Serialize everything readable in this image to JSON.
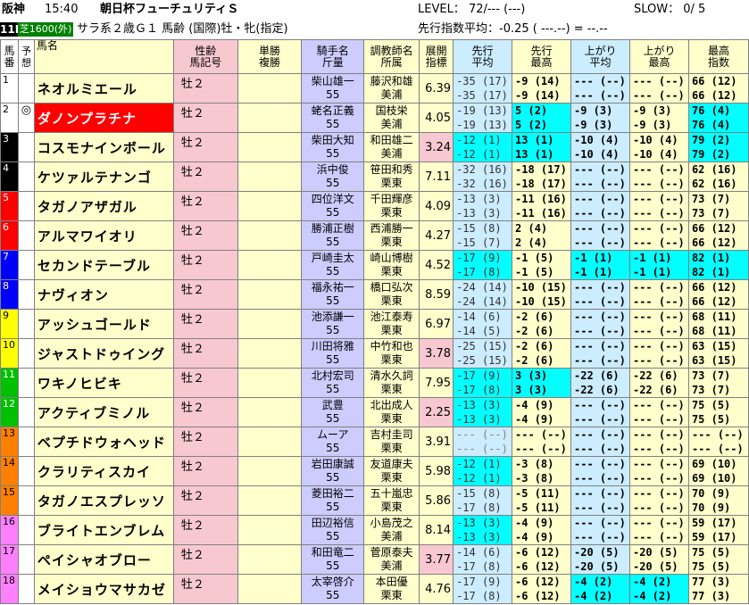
{
  "header": {
    "track": "阪神",
    "time": "15:40",
    "race_name": "朝日杯フューチュリティＳ",
    "level": "LEVEL： 72/--- (---)",
    "slow": "SLOW： 0/ 5",
    "race_no": "11R",
    "course": "芝1600(外)",
    "conditions": "サラ系２歳Ｇ１ 馬齢 (国際)牡・牝(指定)",
    "pace": "先行指数平均：-0.25 ( ---.--) = --.--"
  },
  "columns": {
    "umaban": "馬番",
    "yoso": "予想",
    "name": "馬名",
    "sex_age": "性齢\n馬記号",
    "odds": "単勝\n複勝",
    "jockey": "騎手名\n斤量",
    "trainer": "調教師名\n所属",
    "tenkai": "展開\n指標",
    "senko_avg": "先行\n平均",
    "senko_max": "先行\n最高",
    "agari_avg": "上がり\n平均",
    "agari_max": "上がり\n最高",
    "max_index": "最高\n指数"
  },
  "colors": {
    "waku1": "#ffffff",
    "waku2": "#ffffff",
    "waku3": "#000000",
    "waku4": "#000000",
    "waku5": "#ff0000",
    "waku6": "#ff0000",
    "waku7": "#0000ff",
    "waku8": "#0000ff",
    "waku9": "#ffff00",
    "waku10": "#ffff00",
    "waku11": "#00c000",
    "waku12": "#00c000",
    "waku13": "#ff8000",
    "waku14": "#ff8000",
    "waku15": "#ff8000",
    "waku16": "#ff80ff",
    "waku17": "#ff80ff",
    "waku18": "#ff80ff",
    "highlight": "#00ffff"
  },
  "horses": [
    {
      "no": "1",
      "mark": "",
      "name": "ネオルミエール",
      "sex": "牡２",
      "jockey": "柴山雄一",
      "weight": "55",
      "trainer": "藤沢和雄",
      "stable": "美浦",
      "tenkai": "6.39",
      "s1a": "-35 (17)",
      "s1b": "-35 (17)",
      "s2a": "-9 (14)",
      "s2b": "-9 (14)",
      "a1a": "--- (--)",
      "a1b": "--- (--)",
      "a2a": "--- (--)",
      "a2b": "--- (--)",
      "m1": "66 (12)",
      "m2": "66 (12)"
    },
    {
      "no": "2",
      "mark": "◎",
      "name": "ダノンプラチナ",
      "sex": "牡２",
      "jockey": "蛯名正義",
      "weight": "55",
      "trainer": "国枝栄",
      "stable": "美浦",
      "tenkai": "4.05",
      "s1a": "-19 (13)",
      "s1b": "-19 (13)",
      "s2a": "5 (2)",
      "s2b": "5 (2)",
      "a1a": "-9 (3)",
      "a1b": "-9 (3)",
      "a2a": "-9 (3)",
      "a2b": "-9 (3)",
      "m1": "76 (4)",
      "m2": "76 (4)"
    },
    {
      "no": "3",
      "mark": "",
      "name": "コスモナインボール",
      "sex": "牡２",
      "jockey": "柴田大知",
      "weight": "55",
      "trainer": "和田雄二",
      "stable": "美浦",
      "tenkai": "3.24",
      "s1a": "-12 (1)",
      "s1b": "-12 (1)",
      "s2a": "13 (1)",
      "s2b": "13 (1)",
      "a1a": "-10 (4)",
      "a1b": "-10 (4)",
      "a2a": "-10 (4)",
      "a2b": "-10 (4)",
      "m1": "79 (2)",
      "m2": "79 (2)"
    },
    {
      "no": "4",
      "mark": "",
      "name": "ケツァルテナンゴ",
      "sex": "牡２",
      "jockey": "浜中俊",
      "weight": "55",
      "trainer": "笹田和秀",
      "stable": "栗東",
      "tenkai": "7.11",
      "s1a": "-32 (16)",
      "s1b": "-32 (16)",
      "s2a": "-18 (17)",
      "s2b": "-18 (17)",
      "a1a": "--- (--)",
      "a1b": "--- (--)",
      "a2a": "--- (--)",
      "a2b": "--- (--)",
      "m1": "62 (16)",
      "m2": "62 (16)"
    },
    {
      "no": "5",
      "mark": "",
      "name": "タガノアザガル",
      "sex": "牡２",
      "jockey": "四位洋文",
      "weight": "55",
      "trainer": "千田輝彦",
      "stable": "栗東",
      "tenkai": "4.09",
      "s1a": "-13 (3)",
      "s1b": "-13 (3)",
      "s2a": "-11 (16)",
      "s2b": "-11 (16)",
      "a1a": "--- (--)",
      "a1b": "--- (--)",
      "a2a": "--- (--)",
      "a2b": "--- (--)",
      "m1": "73 (7)",
      "m2": "73 (7)"
    },
    {
      "no": "6",
      "mark": "",
      "name": "アルマワイオリ",
      "sex": "牡２",
      "jockey": "勝浦正樹",
      "weight": "55",
      "trainer": "西浦勝一",
      "stable": "栗東",
      "tenkai": "4.27",
      "s1a": "-15 (8)",
      "s1b": "-15 (7)",
      "s2a": "2 (4)",
      "s2b": "2 (4)",
      "a1a": "--- (--)",
      "a1b": "--- (--)",
      "a2a": "--- (--)",
      "a2b": "--- (--)",
      "m1": "66 (12)",
      "m2": "66 (12)"
    },
    {
      "no": "7",
      "mark": "",
      "name": "セカンドテーブル",
      "sex": "牡２",
      "jockey": "戸崎圭太",
      "weight": "55",
      "trainer": "崎山博樹",
      "stable": "栗東",
      "tenkai": "4.52",
      "s1a": "-17 (9)",
      "s1b": "-17 (8)",
      "s2a": "-1 (5)",
      "s2b": "-1 (5)",
      "a1a": "-1 (1)",
      "a1b": "-1 (1)",
      "a2a": "-1 (1)",
      "a2b": "-1 (1)",
      "m1": "82 (1)",
      "m2": "82 (1)"
    },
    {
      "no": "8",
      "mark": "",
      "name": "ナヴィオン",
      "sex": "牡２",
      "jockey": "福永祐一",
      "weight": "55",
      "trainer": "橋口弘次",
      "stable": "栗東",
      "tenkai": "8.59",
      "s1a": "-24 (14)",
      "s1b": "-24 (14)",
      "s2a": "-10 (15)",
      "s2b": "-10 (15)",
      "a1a": "--- (--)",
      "a1b": "--- (--)",
      "a2a": "--- (--)",
      "a2b": "--- (--)",
      "m1": "66 (12)",
      "m2": "66 (12)"
    },
    {
      "no": "9",
      "mark": "",
      "name": "アッシュゴールド",
      "sex": "牡２",
      "jockey": "池添謙一",
      "weight": "55",
      "trainer": "池江泰寿",
      "stable": "栗東",
      "tenkai": "6.97",
      "s1a": "-14 (6)",
      "s1b": "-14 (5)",
      "s2a": "-2 (6)",
      "s2b": "-2 (6)",
      "a1a": "--- (--)",
      "a1b": "--- (--)",
      "a2a": "--- (--)",
      "a2b": "--- (--)",
      "m1": "68 (11)",
      "m2": "68 (11)"
    },
    {
      "no": "10",
      "mark": "",
      "name": "ジャストドゥイング",
      "sex": "牡２",
      "jockey": "川田将雅",
      "weight": "55",
      "trainer": "中竹和也",
      "stable": "栗東",
      "tenkai": "3.78",
      "s1a": "-25 (15)",
      "s1b": "-25 (15)",
      "s2a": "-2 (6)",
      "s2b": "-2 (6)",
      "a1a": "--- (--)",
      "a1b": "--- (--)",
      "a2a": "--- (--)",
      "a2b": "--- (--)",
      "m1": "63 (15)",
      "m2": "63 (15)"
    },
    {
      "no": "11",
      "mark": "",
      "name": "ワキノヒビキ",
      "sex": "牡２",
      "jockey": "北村宏司",
      "weight": "55",
      "trainer": "清水久詞",
      "stable": "栗東",
      "tenkai": "7.95",
      "s1a": "-17 (9)",
      "s1b": "-17 (8)",
      "s2a": "3 (3)",
      "s2b": "3 (3)",
      "a1a": "-22 (6)",
      "a1b": "-22 (6)",
      "a2a": "-22 (6)",
      "a2b": "-22 (6)",
      "m1": "73 (7)",
      "m2": "73 (7)"
    },
    {
      "no": "12",
      "mark": "",
      "name": "アクティブミノル",
      "sex": "牡２",
      "jockey": "武豊",
      "weight": "55",
      "trainer": "北出成人",
      "stable": "栗東",
      "tenkai": "2.25",
      "s1a": "-13 (3)",
      "s1b": "-13 (3)",
      "s2a": "-4 (9)",
      "s2b": "-4 (9)",
      "a1a": "--- (--)",
      "a1b": "--- (--)",
      "a2a": "--- (--)",
      "a2b": "--- (--)",
      "m1": "75 (5)",
      "m2": "75 (5)"
    },
    {
      "no": "13",
      "mark": "",
      "name": "ベプチドウォヘッド",
      "sex": "牡２",
      "jockey": "ムーア",
      "weight": "55",
      "trainer": "吉村圭司",
      "stable": "栗東",
      "tenkai": "3.91",
      "s1a": "--- (--)",
      "s1b": "--- (--)",
      "s2a": "--- (--)",
      "s2b": "--- (--)",
      "a1a": "--- (--)",
      "a1b": "--- (--)",
      "a2a": "--- (--)",
      "a2b": "--- (--)",
      "m1": "--- (--)",
      "m2": "--- (--)"
    },
    {
      "no": "14",
      "mark": "",
      "name": "クラリティスカイ",
      "sex": "牡２",
      "jockey": "岩田康誠",
      "weight": "55",
      "trainer": "友道康夫",
      "stable": "栗東",
      "tenkai": "5.98",
      "s1a": "-12 (1)",
      "s1b": "-12 (1)",
      "s2a": "-3 (8)",
      "s2b": "-3 (8)",
      "a1a": "--- (--)",
      "a1b": "--- (--)",
      "a2a": "--- (--)",
      "a2b": "--- (--)",
      "m1": "69 (10)",
      "m2": "69 (10)"
    },
    {
      "no": "15",
      "mark": "",
      "name": "タガノエスプレッソ",
      "sex": "牡２",
      "jockey": "菱田裕二",
      "weight": "55",
      "trainer": "五十嵐忠",
      "stable": "栗東",
      "tenkai": "5.86",
      "s1a": "-15 (8)",
      "s1b": "-17 (8)",
      "s2a": "-5 (11)",
      "s2b": "-5 (11)",
      "a1a": "--- (--)",
      "a1b": "--- (--)",
      "a2a": "--- (--)",
      "a2b": "--- (--)",
      "m1": "70 (9)",
      "m2": "70 (9)"
    },
    {
      "no": "16",
      "mark": "",
      "name": "ブライトエンブレム",
      "sex": "牡２",
      "jockey": "田辺裕信",
      "weight": "55",
      "trainer": "小島茂之",
      "stable": "美浦",
      "tenkai": "8.14",
      "s1a": "-13 (3)",
      "s1b": "-13 (3)",
      "s2a": "-4 (9)",
      "s2b": "-4 (9)",
      "a1a": "--- (--)",
      "a1b": "--- (--)",
      "a2a": "--- (--)",
      "a2b": "--- (--)",
      "m1": "59 (17)",
      "m2": "59 (17)"
    },
    {
      "no": "17",
      "mark": "",
      "name": "ペイシャオブロー",
      "sex": "牡２",
      "jockey": "和田竜二",
      "weight": "55",
      "trainer": "菅原泰夫",
      "stable": "美浦",
      "tenkai": "3.77",
      "s1a": "-14 (6)",
      "s1b": "-17 (8)",
      "s2a": "-6 (12)",
      "s2b": "-6 (12)",
      "a1a": "-20 (5)",
      "a1b": "-20 (5)",
      "a2a": "-20 (5)",
      "a2b": "-20 (5)",
      "m1": "75 (5)",
      "m2": "75 (5)"
    },
    {
      "no": "18",
      "mark": "",
      "name": "メイショウマサカゼ",
      "sex": "牡２",
      "jockey": "太宰啓介",
      "weight": "55",
      "trainer": "本田優",
      "stable": "栗東",
      "tenkai": "4.76",
      "s1a": "-17 (9)",
      "s1b": "-17 (8)",
      "s2a": "-6 (12)",
      "s2b": "-6 (12)",
      "a1a": "-4 (2)",
      "a1b": "-4 (2)",
      "a2a": "-4 (2)",
      "a2b": "-4 (2)",
      "m1": "77 (3)",
      "m2": "77 (3)"
    }
  ]
}
